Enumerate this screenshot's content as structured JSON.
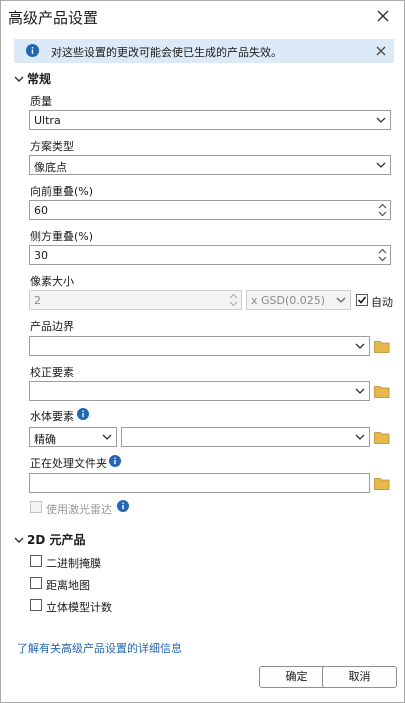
{
  "dialog": {
    "title": "高级产品设置"
  },
  "info": {
    "message": "对这些设置的更改可能会使已生成的产品失效。"
  },
  "general": {
    "section_title": "常规",
    "quality_label": "质量",
    "quality_value": "Ultra",
    "scenario_label": "方案类型",
    "scenario_value": "像底点",
    "forward_label": "向前重叠(%)",
    "forward_value": "60",
    "side_label": "侧方重叠(%)",
    "side_value": "30",
    "pixel_label": "像素大小",
    "pixel_value": "2",
    "pixel_unit_value": "x GSD(0.025)",
    "auto_label": "自动",
    "boundary_label": "产品边界",
    "boundary_value": "",
    "correction_label": "校正要素",
    "correction_value": "",
    "water_label": "水体要素",
    "water_mode_value": "精确",
    "water_value": "",
    "folder_label": "正在处理文件夹",
    "folder_value": "",
    "lidar_label": "使用激光雷达"
  },
  "products2d": {
    "section_title": "2D 元产品",
    "items": [
      "二进制掩膜",
      "距离地图",
      "立体模型计数"
    ]
  },
  "footer": {
    "link": "了解有关高级产品设置的详细信息",
    "ok": "确定",
    "cancel": "取消"
  },
  "colors": {
    "accent": "#2267b5",
    "info_bg": "#dce9f6",
    "folder": "#e8b84a"
  }
}
